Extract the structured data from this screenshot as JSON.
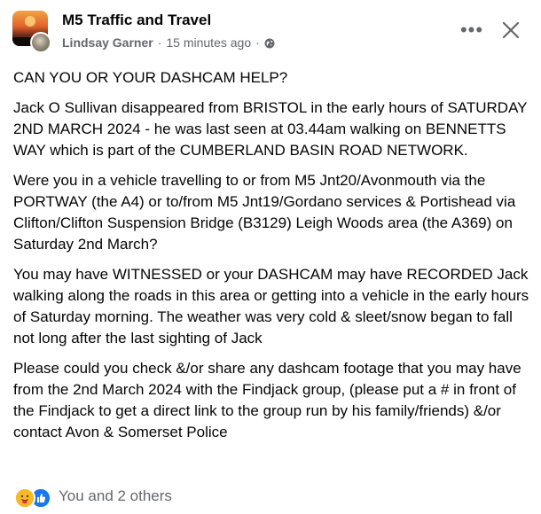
{
  "header": {
    "group_name": "M5 Traffic and Travel",
    "author": "Lindsay Garner",
    "separator": "·",
    "timestamp": "15 minutes ago",
    "separator2": "·",
    "privacy_icon": "globe-icon",
    "more_label": "•••",
    "close_icon": "close-icon"
  },
  "post": {
    "paragraphs": [
      "CAN YOU OR YOUR DASHCAM HELP?",
      "Jack O Sullivan disappeared from BRISTOL in the early hours of SATURDAY 2ND MARCH 2024 - he was last seen at 03.44am walking on BENNETTS WAY  which is part of the CUMBERLAND BASIN ROAD NETWORK.",
      "Were you in a vehicle travelling to or from M5 Jnt20/Avonmouth via the PORTWAY (the A4) or to/from M5 Jnt19/Gordano services & Portishead via Clifton/Clifton Suspension Bridge (B3129) Leigh Woods area (the A369) on Saturday 2nd March?",
      "You may have WITNESSED or your DASHCAM may have RECORDED Jack walking along the roads in this area or getting into a vehicle in the early hours of Saturday morning. The weather was very cold & sleet/snow began to fall not long after the last sighting of Jack",
      "Please could you check &/or share any dashcam footage that you may have from the 2nd March 2024 with the Findjack group, (please put a # in front of the Findjack to get a direct link to the group run by his family/friends) &/or contact Avon & Somerset Police"
    ]
  },
  "reactions": {
    "icons": [
      "care-icon",
      "like-icon"
    ],
    "text": "You and 2 others"
  },
  "colors": {
    "text_primary": "#050505",
    "text_secondary": "#65676b",
    "like_blue": "#1877f2",
    "care_yellow": "#f7b928"
  }
}
